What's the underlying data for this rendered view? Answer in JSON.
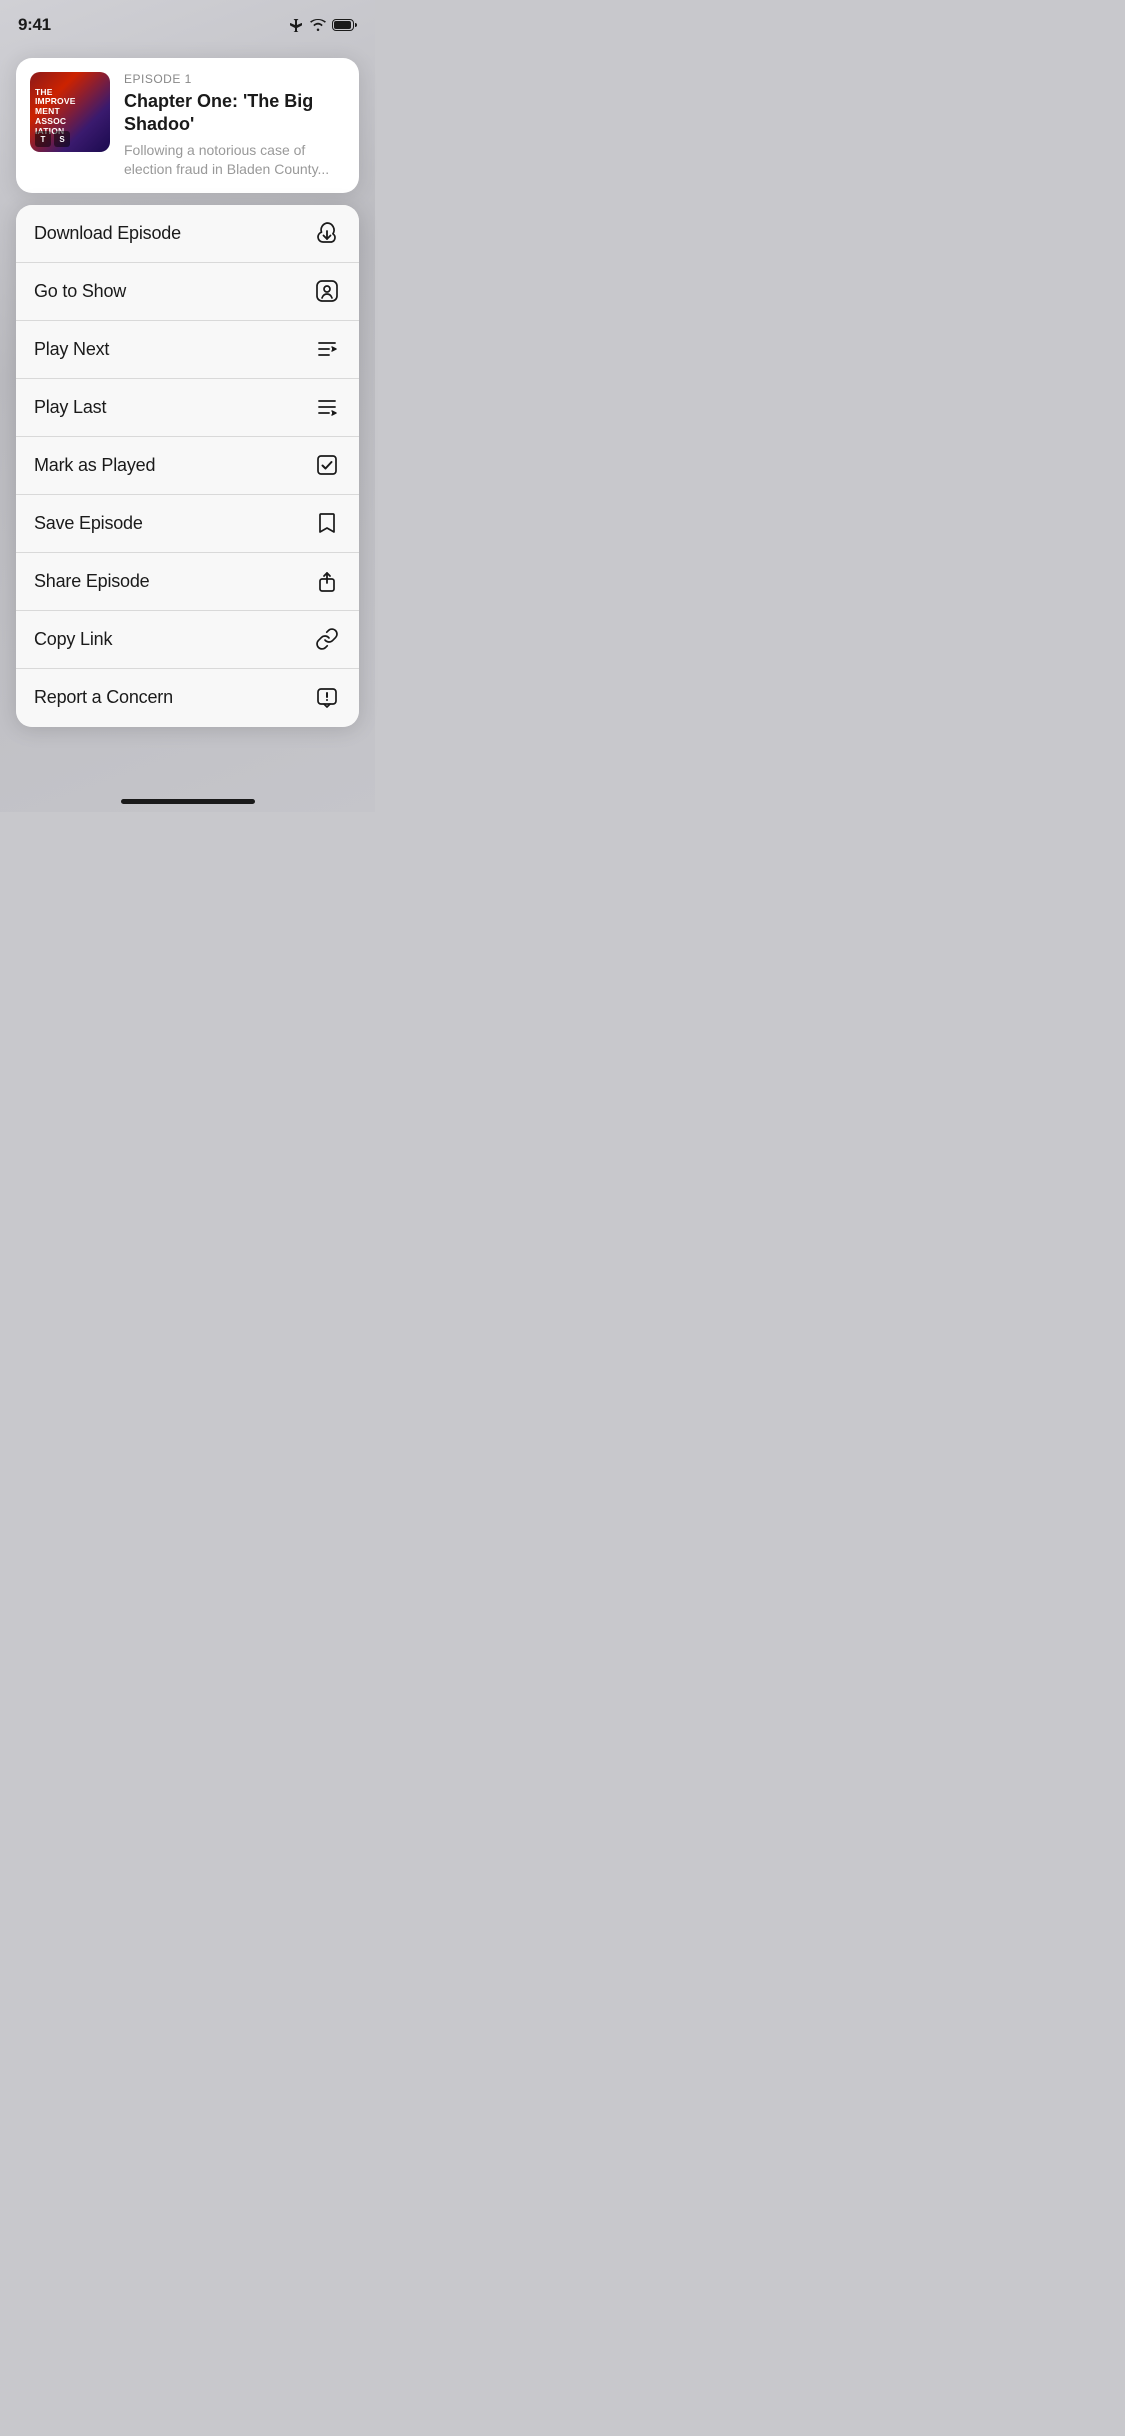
{
  "statusBar": {
    "time": "9:41"
  },
  "episodeCard": {
    "episodeLabel": "EPISODE 1",
    "title": "Chapter One: 'The Big Shadoo'",
    "description": "Following a notorious case of election fraud in Bladen County...",
    "artwork": {
      "line1": "THE",
      "line2": "IMPROVE",
      "line3": "MENT",
      "line4": "ASSOC",
      "line5": "IATION",
      "logo1": "T",
      "logo2": "S"
    }
  },
  "menuItems": [
    {
      "id": "download",
      "label": "Download Episode"
    },
    {
      "id": "goto-show",
      "label": "Go to Show"
    },
    {
      "id": "play-next",
      "label": "Play Next"
    },
    {
      "id": "play-last",
      "label": "Play Last"
    },
    {
      "id": "mark-played",
      "label": "Mark as Played"
    },
    {
      "id": "save-episode",
      "label": "Save Episode"
    },
    {
      "id": "share-episode",
      "label": "Share Episode"
    },
    {
      "id": "copy-link",
      "label": "Copy Link"
    },
    {
      "id": "report-concern",
      "label": "Report a Concern"
    }
  ]
}
